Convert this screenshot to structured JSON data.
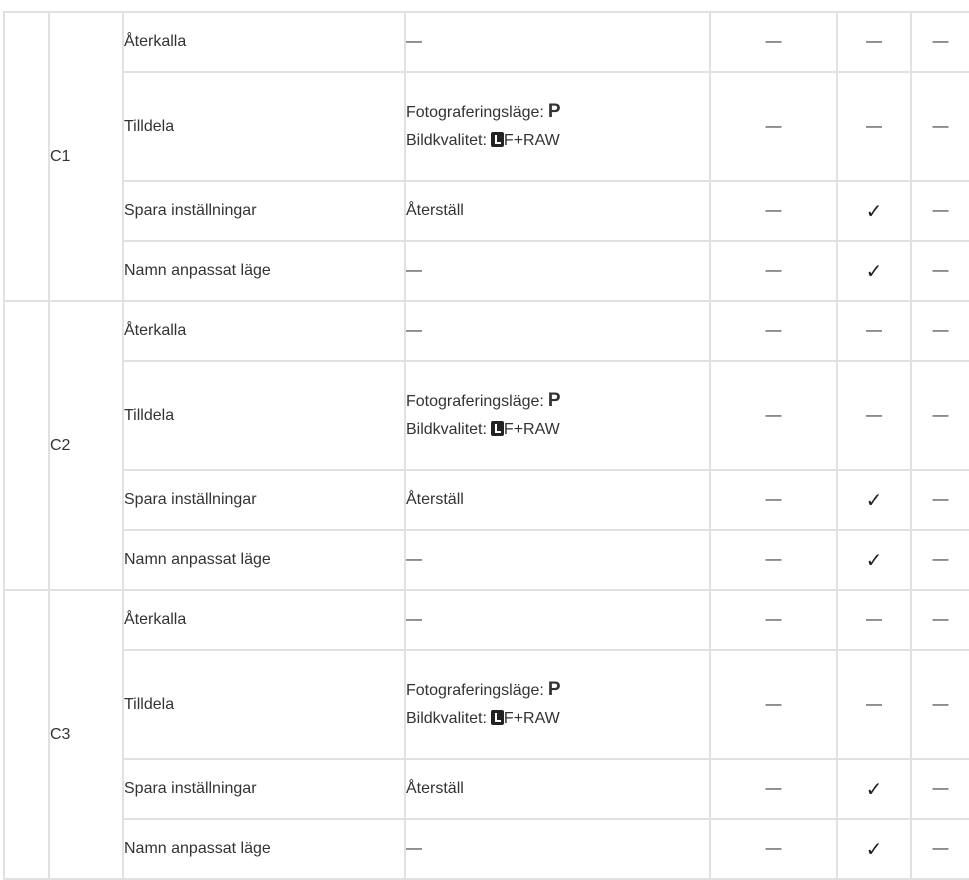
{
  "groups": [
    {
      "mode": "C1",
      "rows": [
        {
          "function": "Återkalla",
          "value": "—",
          "a": "—",
          "b": "—",
          "c": "—"
        },
        {
          "function": "Tilldela",
          "value_line1_label": "Fotograferingsläge:",
          "value_line1_bold": "P",
          "value_line2_label": "Bildkvalitet:",
          "value_line2_suffix": "F+RAW",
          "a": "—",
          "b": "—",
          "c": "—"
        },
        {
          "function": "Spara inställningar",
          "value": "Återställ",
          "a": "—",
          "b": "✓",
          "c": "—"
        },
        {
          "function": "Namn anpassat läge",
          "value": "—",
          "a": "—",
          "b": "✓",
          "c": "—"
        }
      ]
    },
    {
      "mode": "C2",
      "rows": [
        {
          "function": "Återkalla",
          "value": "—",
          "a": "—",
          "b": "—",
          "c": "—"
        },
        {
          "function": "Tilldela",
          "value_line1_label": "Fotograferingsläge:",
          "value_line1_bold": "P",
          "value_line2_label": "Bildkvalitet:",
          "value_line2_suffix": "F+RAW",
          "a": "—",
          "b": "—",
          "c": "—"
        },
        {
          "function": "Spara inställningar",
          "value": "Återställ",
          "a": "—",
          "b": "✓",
          "c": "—"
        },
        {
          "function": "Namn anpassat läge",
          "value": "—",
          "a": "—",
          "b": "✓",
          "c": "—"
        }
      ]
    },
    {
      "mode": "C3",
      "rows": [
        {
          "function": "Återkalla",
          "value": "—",
          "a": "—",
          "b": "—",
          "c": "—"
        },
        {
          "function": "Tilldela",
          "value_line1_label": "Fotograferingsläge:",
          "value_line1_bold": "P",
          "value_line2_label": "Bildkvalitet:",
          "value_line2_suffix": "F+RAW",
          "a": "—",
          "b": "—",
          "c": "—"
        },
        {
          "function": "Spara inställningar",
          "value": "Återställ",
          "a": "—",
          "b": "✓",
          "c": "—"
        },
        {
          "function": "Namn anpassat läge",
          "value": "—",
          "a": "—",
          "b": "✓",
          "c": "—"
        }
      ]
    }
  ],
  "icons": {
    "image_quality_icon": "large-size-L-icon",
    "check_mark": "check-icon"
  },
  "colors": {
    "border": "#e1e1e1",
    "text": "#333333"
  }
}
